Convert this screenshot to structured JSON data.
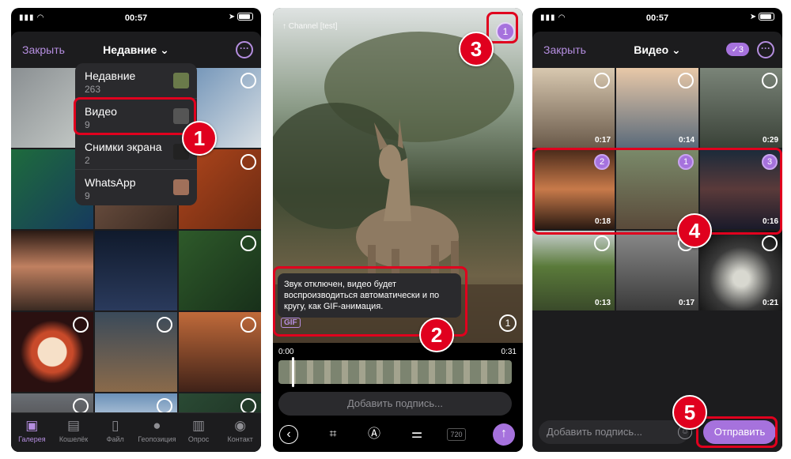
{
  "status": {
    "time": "00:57"
  },
  "gallery": {
    "close_label": "Закрыть",
    "title": "Недавние ⌄",
    "more": "···",
    "albums": [
      {
        "name": "Недавние",
        "count": "263"
      },
      {
        "name": "Видео",
        "count": "9"
      },
      {
        "name": "Снимки экрана",
        "count": "2"
      },
      {
        "name": "WhatsApp",
        "count": "9"
      }
    ],
    "tabs": [
      "Галерея",
      "Кошелёк",
      "Файл",
      "Геопозиция",
      "Опрос",
      "Контакт"
    ]
  },
  "editor": {
    "channel": "↑ Channel [test]",
    "selected_index": "1",
    "tooltip": "Звук отключен, видео будет воспроизводиться автоматически и по кругу, как GIF-анимация.",
    "gif_label": "GIF",
    "mute_index": "1",
    "time_start": "0:00",
    "time_end": "0:31",
    "caption_placeholder": "Добавить подпись...",
    "quality": "720"
  },
  "videos": {
    "close_label": "Закрыть",
    "title": "Видео ⌄",
    "selected_count": "✓3",
    "more": "···",
    "durations": [
      "0:17",
      "0:14",
      "0:29",
      "0:18",
      "",
      "0:16",
      "0:13",
      "0:17",
      "0:21"
    ],
    "selection": [
      "",
      "",
      "",
      "2",
      "1",
      "3",
      "",
      "",
      ""
    ],
    "caption_placeholder": "Добавить подпись...",
    "send_label": "Отправить"
  },
  "steps": [
    "1",
    "2",
    "3",
    "4",
    "5"
  ]
}
